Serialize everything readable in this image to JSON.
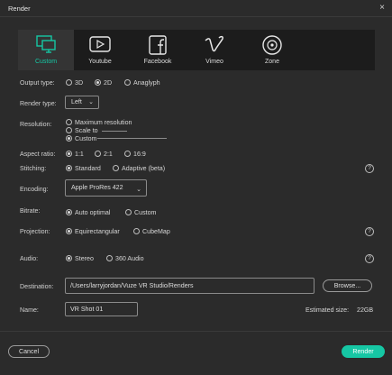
{
  "window": {
    "title": "Render",
    "close_glyph": "×"
  },
  "presets": [
    {
      "label": "Custom",
      "icon": "monitor-icon",
      "active": true
    },
    {
      "label": "Youtube",
      "icon": "youtube-icon",
      "active": false
    },
    {
      "label": "Facebook",
      "icon": "facebook-icon",
      "active": false
    },
    {
      "label": "Vimeo",
      "icon": "vimeo-icon",
      "active": false
    },
    {
      "label": "Zone",
      "icon": "zone-icon",
      "active": false
    }
  ],
  "output_type": {
    "label": "Output type:",
    "options": [
      "3D",
      "2D",
      "Anaglyph"
    ],
    "selected": "2D"
  },
  "render_type": {
    "label": "Render type:",
    "value": "Left"
  },
  "resolution": {
    "label": "Resolution:",
    "options": [
      "Maximum resolution",
      "Scale to",
      "Custom"
    ],
    "selected": "Custom"
  },
  "aspect_ratio": {
    "label": "Aspect ratio:",
    "options": [
      "1:1",
      "2:1",
      "16:9"
    ],
    "selected": "1:1"
  },
  "stitching": {
    "label": "Stitching:",
    "options": [
      "Standard",
      "Adaptive (beta)"
    ],
    "selected": "Standard"
  },
  "encoding": {
    "label": "Encoding:",
    "value": "Apple ProRes 422"
  },
  "bitrate": {
    "label": "Bitrate:",
    "options": [
      "Auto optimal",
      "Custom"
    ],
    "selected": "Auto optimal"
  },
  "projection": {
    "label": "Projection:",
    "options": [
      "Equirectangular",
      "CubeMap"
    ],
    "selected": "Equirectangular"
  },
  "audio": {
    "label": "Audio:",
    "options": [
      "Stereo",
      "360 Audio"
    ],
    "selected": "Stereo"
  },
  "destination": {
    "label": "Destination:",
    "value": "/Users/larryjordan/Vuze VR Studio/Renders",
    "browse": "Browse..."
  },
  "name": {
    "label": "Name:",
    "value": "VR Shot 01"
  },
  "estimated": {
    "label": "Estimated size:",
    "value": "22GB"
  },
  "help_glyph": "?",
  "chevron_glyph": "⌄",
  "actions": {
    "cancel": "Cancel",
    "render": "Render"
  },
  "colors": {
    "accent": "#16c7a4",
    "background": "#2b2b2b",
    "preset_bar": "#1c1c1c"
  }
}
